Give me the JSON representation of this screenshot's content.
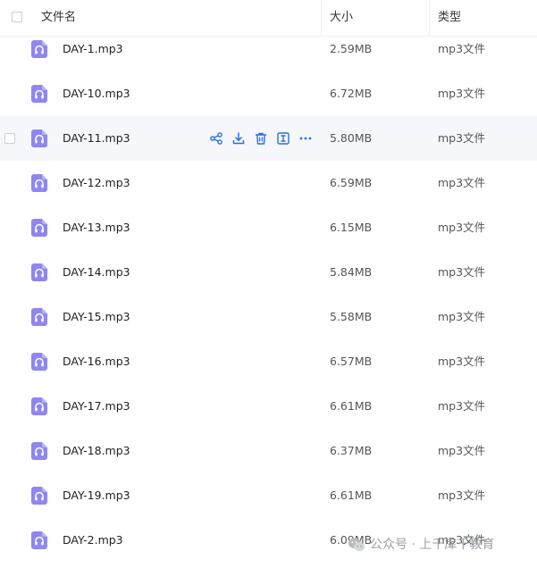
{
  "header": {
    "name_label": "文件名",
    "size_label": "大小",
    "type_label": "类型"
  },
  "colors": {
    "accent": "#2b6fe0",
    "file_icon": "#8f86f0",
    "hover_row": "#f5f7fb"
  },
  "files": [
    {
      "name": "DAY-1.mp3",
      "size": "2.59MB",
      "type": "mp3文件"
    },
    {
      "name": "DAY-10.mp3",
      "size": "6.72MB",
      "type": "mp3文件"
    },
    {
      "name": "DAY-11.mp3",
      "size": "5.80MB",
      "type": "mp3文件"
    },
    {
      "name": "DAY-12.mp3",
      "size": "6.59MB",
      "type": "mp3文件"
    },
    {
      "name": "DAY-13.mp3",
      "size": "6.15MB",
      "type": "mp3文件"
    },
    {
      "name": "DAY-14.mp3",
      "size": "5.84MB",
      "type": "mp3文件"
    },
    {
      "name": "DAY-15.mp3",
      "size": "5.58MB",
      "type": "mp3文件"
    },
    {
      "name": "DAY-16.mp3",
      "size": "6.57MB",
      "type": "mp3文件"
    },
    {
      "name": "DAY-17.mp3",
      "size": "6.61MB",
      "type": "mp3文件"
    },
    {
      "name": "DAY-18.mp3",
      "size": "6.37MB",
      "type": "mp3文件"
    },
    {
      "name": "DAY-19.mp3",
      "size": "6.61MB",
      "type": "mp3文件"
    },
    {
      "name": "DAY-2.mp3",
      "size": "6.09MB",
      "type": "mp3文件"
    }
  ],
  "hover_row_index": 2,
  "row_actions": [
    "share-icon",
    "download-icon",
    "delete-icon",
    "rename-icon",
    "more-icon"
  ],
  "watermark": {
    "text": "公众号 · 上千库千教育"
  }
}
